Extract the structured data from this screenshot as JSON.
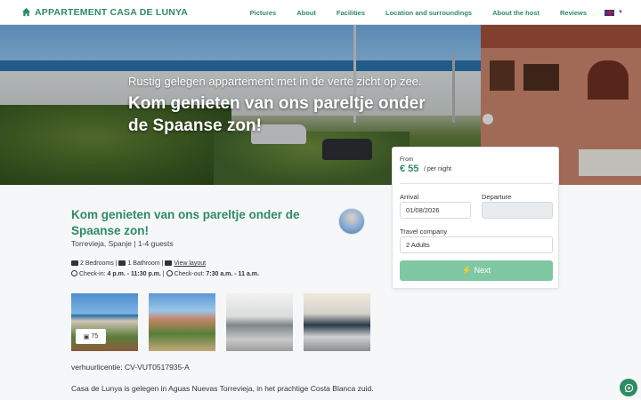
{
  "nav": {
    "brand": "APPARTEMENT CASA DE LUNYA",
    "links": [
      "Pictures",
      "About",
      "Facilities",
      "Location and surroundings",
      "About the host",
      "Reviews"
    ]
  },
  "hero": {
    "subtitle": "Rustig gelegen appartement met in de verte zicht op zee.",
    "title": "Kom genieten van ons pareltje onder de Spaanse zon!"
  },
  "booking": {
    "from_label": "From",
    "price": "€ 55",
    "per_night": "/ per night",
    "arrival_label": "Arrival",
    "arrival_value": "01/08/2026",
    "departure_label": "Departure",
    "departure_value": "",
    "travel_label": "Travel company",
    "travel_value": "2 Adults",
    "next_label": "Next"
  },
  "property": {
    "title": "Kom genieten van ons pareltje onder de Spaanse zon!",
    "location": "Torrevieja, Spanje | 1-4 guests",
    "bedrooms": "2 Bedrooms",
    "bathroom": "1 Bathroom",
    "layout": "View layout",
    "checkin_label": "Check-in:",
    "checkin_value": "4 p.m. - 11:30 p.m.",
    "checkout_label": "Check-out:",
    "checkout_value": "7:30 a.m. - 11 a.m.",
    "photo_count": "75",
    "license": "verhuurlicentie: CV-VUT0517935-A",
    "description": "Casa de Lunya is gelegen in Aguas Nuevas Torrevieja, in het prachtige Costa Blanca zuid."
  },
  "colors": {
    "brand_green": "#2e8b62",
    "button_green": "#80c8a4"
  }
}
